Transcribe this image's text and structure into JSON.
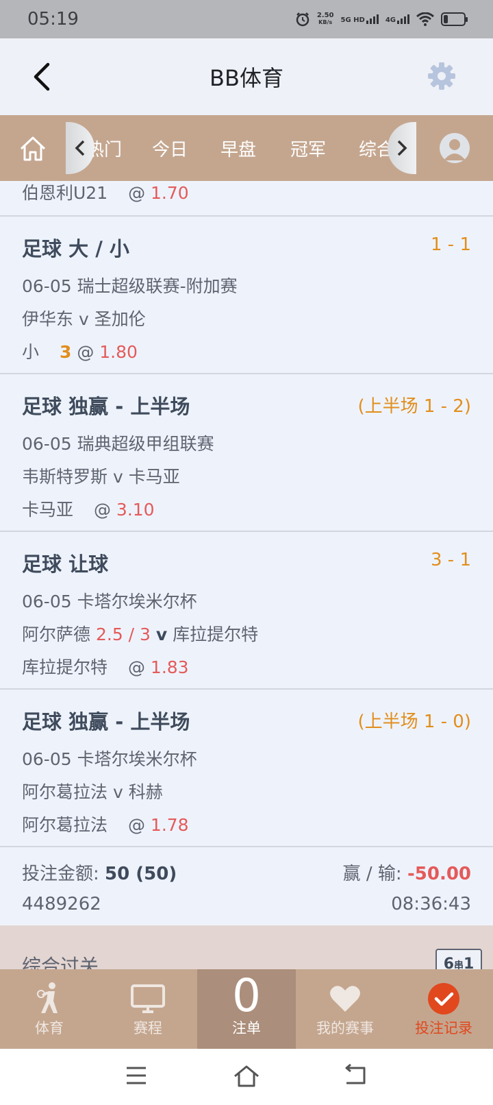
{
  "status_bar": {
    "time": "05:19",
    "net_speed": "2.50",
    "net_unit": "KB/s",
    "sig1": "5G HD",
    "sig2": "4G"
  },
  "header": {
    "title": "BB体育"
  },
  "nav": {
    "tabs": [
      "热门",
      "今日",
      "早盘",
      "冠军",
      "综合过关"
    ]
  },
  "top_row": {
    "team": "伯恩利U21",
    "at": "@",
    "odds": "1.70"
  },
  "bets": [
    {
      "title": "足球 大 / 小",
      "score": "1 - 1",
      "line1": "06-05 瑞士超级联赛-附加赛",
      "line2": "伊华东 v 圣加伦",
      "pick": "小",
      "handicap": "3",
      "at": "@",
      "odds": "1.80"
    },
    {
      "title": "足球 独赢 - 上半场",
      "score": "(上半场 1 - 2)",
      "line1": "06-05 瑞典超级甲组联赛",
      "line2": "韦斯特罗斯 v 卡马亚",
      "pick": "卡马亚",
      "at": "@",
      "odds": "3.10"
    },
    {
      "title": "足球 让球",
      "score": "3 - 1",
      "line1": "06-05 卡塔尔埃米尔杯",
      "line2_a": "阿尔萨德",
      "line2_hcp": "2.5 / 3",
      "line2_v": "v",
      "line2_b": "库拉提尔特",
      "pick": "库拉提尔特",
      "at": "@",
      "odds": "1.83"
    },
    {
      "title": "足球 独赢 - 上半场",
      "score": "(上半场 1 - 0)",
      "line1": "06-05 卡塔尔埃米尔杯",
      "line2": "阿尔葛拉法 v 科赫",
      "pick": "阿尔葛拉法",
      "at": "@",
      "odds": "1.78"
    }
  ],
  "summary": {
    "stake_label": "投注金额:",
    "stake_value": "50 (50)",
    "winloss_label": "赢 / 输:",
    "winloss_value": "-50.00",
    "ticket_id": "4489262",
    "time": "08:36:43"
  },
  "parlay": {
    "title": "综合过关",
    "badge_a": "6",
    "badge_mid": "串",
    "badge_b": "1"
  },
  "tabbar": {
    "sports": "体育",
    "schedule": "赛程",
    "slip_count": "0",
    "slip": "注单",
    "my_events": "我的赛事",
    "records": "投注记录"
  },
  "colors": {
    "nav_bg": "#c4a68f",
    "odds_red": "#e45a5a",
    "score_orange": "#e28e1d",
    "record_red": "#e1481e"
  }
}
